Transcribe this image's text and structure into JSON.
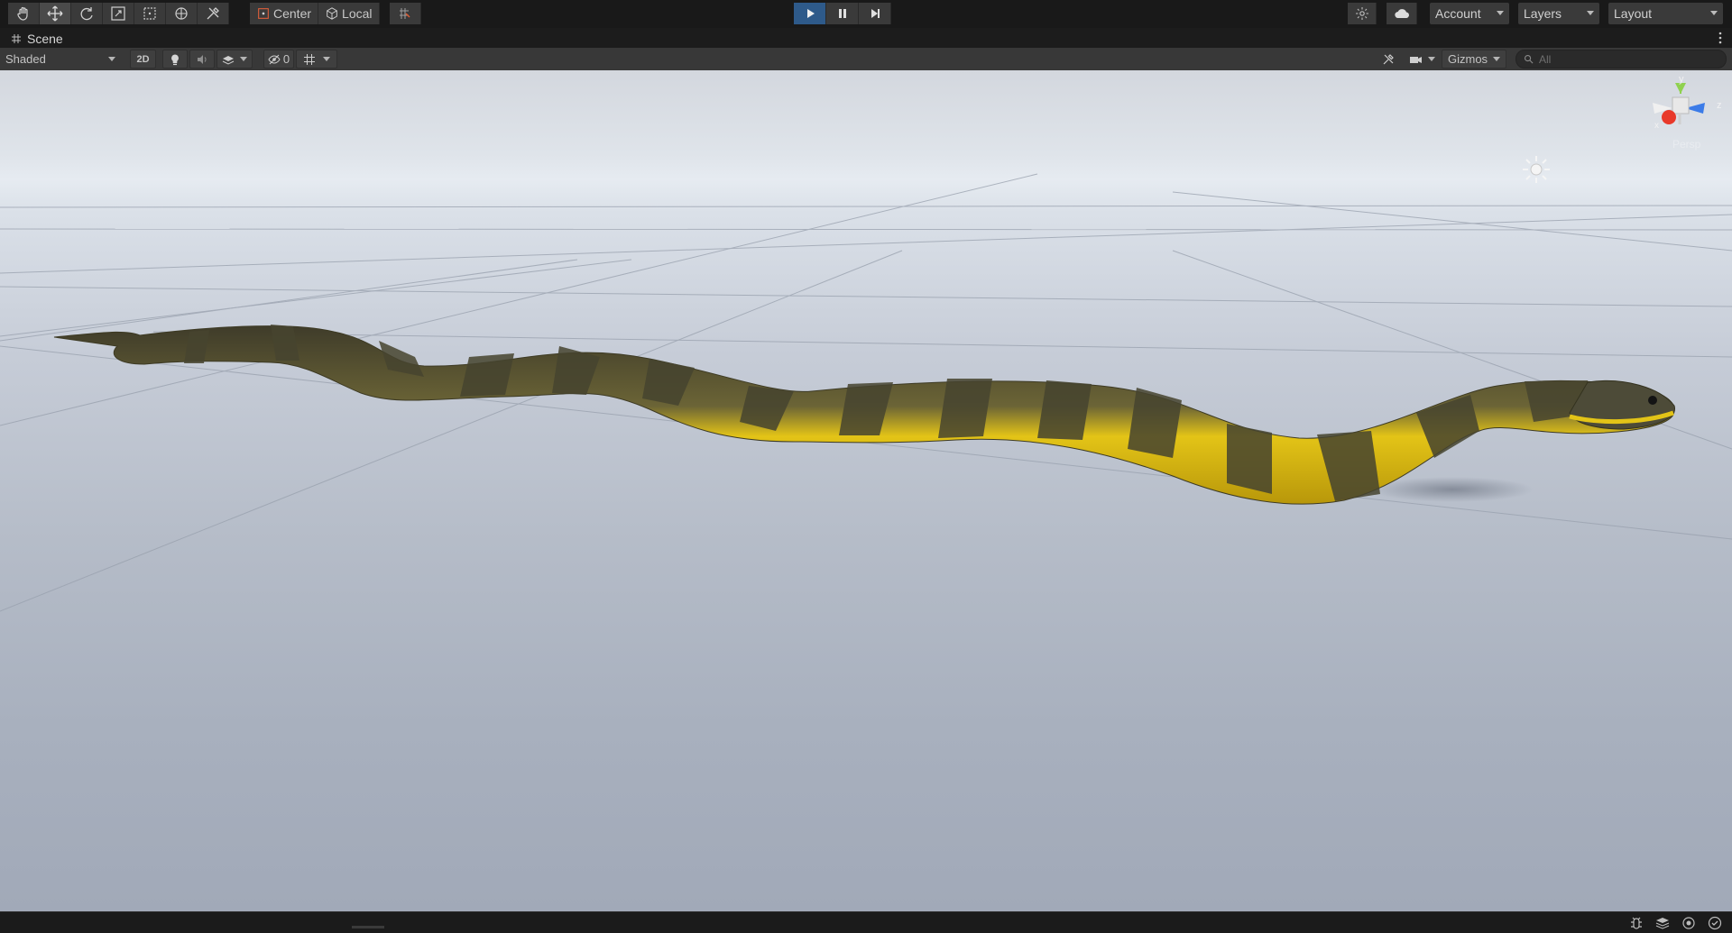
{
  "toolbar": {
    "tools": [
      "hand-tool",
      "move-tool",
      "rotate-tool",
      "scale-tool",
      "rect-tool",
      "transform-tool",
      "custom-tool"
    ],
    "pivot_mode": "Center",
    "pivot_rotation": "Local",
    "play_state": "stopped",
    "account": "Account",
    "layers": "Layers",
    "layout": "Layout"
  },
  "scene_tab": {
    "title": "Scene"
  },
  "scene_toolbar": {
    "draw_mode": "Shaded",
    "toggle_2d": "2D",
    "hidden_count": "0",
    "gizmos": "Gizmos",
    "search_placeholder": "All"
  },
  "orientation_gizmo": {
    "y": "y",
    "x": "x",
    "z": "z",
    "projection": "Persp"
  },
  "colors": {
    "accent_play": "#2e5a8a",
    "snake_yellow": "#e8cc1a",
    "snake_dark": "#55533a",
    "axis_x": "#e8392a",
    "axis_y": "#8fd14f",
    "axis_z": "#3b7be8"
  }
}
